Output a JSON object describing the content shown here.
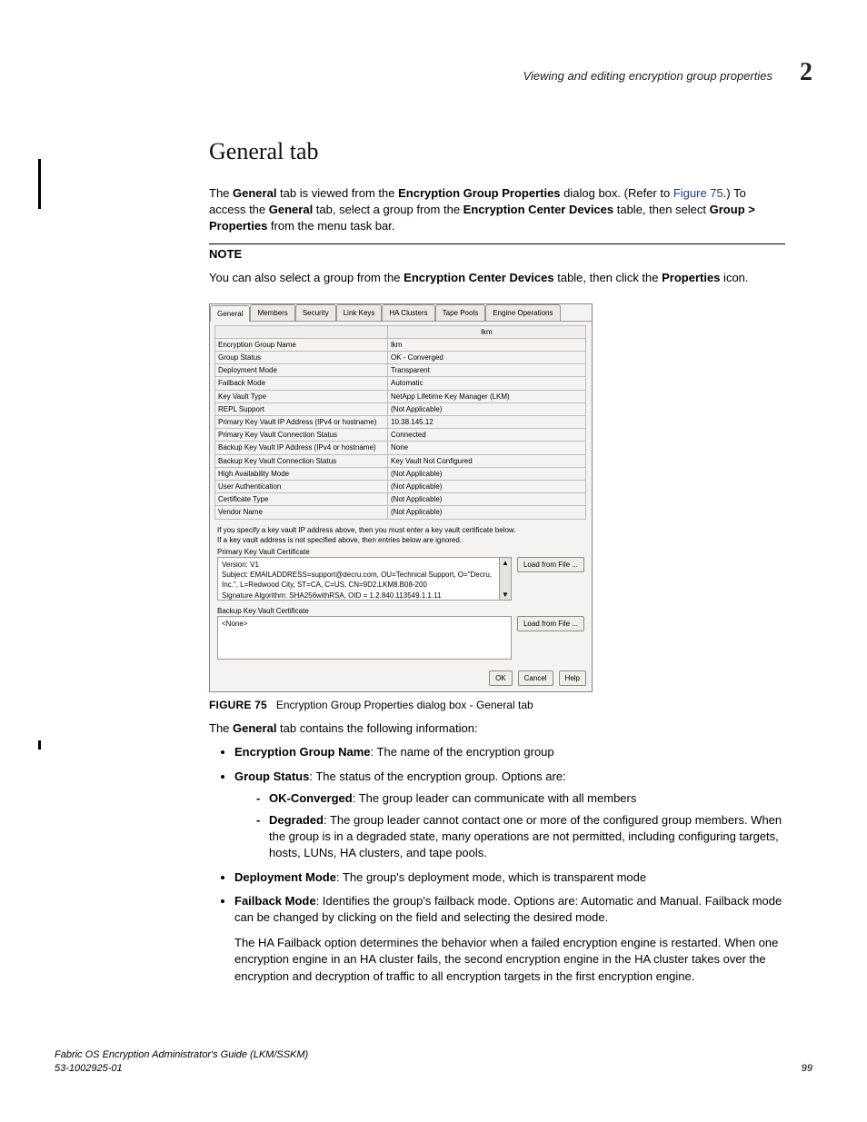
{
  "header": {
    "running_title": "Viewing and editing encryption group properties",
    "chapter_number": "2"
  },
  "section": {
    "title": "General tab",
    "intro_parts": {
      "p1_a": "The ",
      "p1_b": "General",
      "p1_c": " tab is viewed from the ",
      "p1_d": "Encryption Group Properties",
      "p1_e": " dialog box. (Refer to ",
      "p1_link": "Figure 75",
      "p1_f": ".) To access the ",
      "p1_g": "General",
      "p1_h": " tab, select a group from the ",
      "p1_i": "Encryption Center Devices",
      "p1_j": " table, then select ",
      "p1_k": "Group > Properties",
      "p1_l": " from the menu task bar."
    },
    "note": {
      "label": "NOTE",
      "a": "You can also select a group from the ",
      "b": "Encryption Center Devices",
      "c": " table, then click the ",
      "d": "Properties",
      "e": " icon."
    }
  },
  "dialog": {
    "tabs": [
      "General",
      "Members",
      "Security",
      "Link Keys",
      "HA Clusters",
      "Tape Pools",
      "Engine Operations"
    ],
    "header_value": "lkm",
    "rows": [
      {
        "label": "Encryption Group Name",
        "value": "lkm"
      },
      {
        "label": "Group Status",
        "value": "OK - Converged"
      },
      {
        "label": "Deployment Mode",
        "value": "Transparent"
      },
      {
        "label": "Failback Mode",
        "value": "Automatic"
      },
      {
        "label": "Key Vault Type",
        "value": "NetApp Lifetime Key Manager (LKM)"
      },
      {
        "label": "REPL Support",
        "value": "(Not Applicable)"
      },
      {
        "label": "Primary Key Vault IP Address (IPv4 or hostname)",
        "value": "10.38.145.12"
      },
      {
        "label": "Primary Key Vault Connection Status",
        "value": "Connected"
      },
      {
        "label": "Backup Key Vault IP Address (IPv4 or hostname)",
        "value": "None"
      },
      {
        "label": "Backup Key Vault Connection Status",
        "value": "Key Vault Not Configured"
      },
      {
        "label": "High Availability Mode",
        "value": "(Not Applicable)"
      },
      {
        "label": "User Authentication",
        "value": "(Not Applicable)"
      },
      {
        "label": "Certificate Type",
        "value": "(Not Applicable)"
      },
      {
        "label": "Vendor Name",
        "value": "(Not Applicable)"
      }
    ],
    "help_line1": "If you specify a key vault IP address above, then you must enter a key vault certificate below.",
    "help_line2": "If a key vault address is not specified above, then entries below are ignored.",
    "primary_cert_label": "Primary Key Vault Certificate",
    "primary_cert_text": "Version: V1\nSubject: EMAILADDRESS=support@decru.com, OU=Technical Support, O=\"Decru, Inc.\", L=Redwood City, ST=CA, C=US, CN=9D2.LKM8.B08-200\nSignature Algorithm: SHA256withRSA, OID = 1.2.840.113549.1.1.11",
    "backup_cert_label": "Backup Key Vault Certificate",
    "backup_cert_text": "<None>",
    "load_btn": "Load from File ...",
    "ok": "OK",
    "cancel": "Cancel",
    "help": "Help"
  },
  "figure": {
    "label": "FIGURE 75",
    "caption": "Encryption Group Properties dialog box - General tab"
  },
  "content": {
    "lead_a": "The ",
    "lead_b": "General",
    "lead_c": " tab contains the following information:",
    "li1_a": "Encryption Group Name",
    "li1_b": ": The name of the encryption group",
    "li2_a": "Group Status",
    "li2_b": ": The status of the encryption group. Options are:",
    "li2_s1_a": "OK-Converged",
    "li2_s1_b": ": The group leader can communicate with all members",
    "li2_s2_a": "Degraded",
    "li2_s2_b": ": The group leader cannot contact one or more of the configured group members. When the group is in a degraded state, many operations are not permitted, including configuring targets, hosts, LUNs, HA clusters, and tape pools.",
    "li3_a": "Deployment Mode",
    "li3_b": ": The group's deployment mode, which is transparent mode",
    "li4_a": "Failback Mode",
    "li4_b": ": Identifies the group's failback mode. Options are: Automatic and Manual. Failback mode can be changed by clicking on the field and selecting the desired mode.",
    "li4_para": "The HA Failback option determines the behavior when a failed encryption engine is restarted. When one encryption engine in an HA cluster fails, the second encryption engine in the HA cluster takes over the encryption and decryption of traffic to all encryption targets in the first encryption engine."
  },
  "footer": {
    "doc_title": "Fabric OS Encryption Administrator's Guide  (LKM/SSKM)",
    "doc_number": "53-1002925-01",
    "page": "99"
  }
}
